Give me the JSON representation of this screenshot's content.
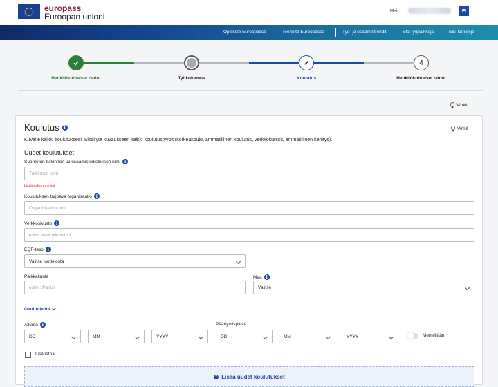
{
  "header": {
    "brand_top": "europass",
    "brand_bottom": "Euroopan unioni",
    "greeting": "Hei",
    "language": "FI",
    "colors": {
      "brand": "#8c1d4e",
      "accent": "#1e48a6"
    }
  },
  "nav": {
    "items": [
      "Opiskele Euroopassa",
      "Tee töitä Euroopassa",
      "Työ- ja osaamistrendit",
      "Etsi työpaikkoja",
      "Etsi kursseja"
    ]
  },
  "stepper": {
    "steps": [
      {
        "label": "Henkilökohtaiset tiedot",
        "state": "completed"
      },
      {
        "label": "Työkokemus",
        "state": "skipped"
      },
      {
        "label": "Koulutus",
        "state": "current"
      },
      {
        "label": "Henkilökohtaiset taidot",
        "state": "upcoming",
        "number": "4"
      }
    ],
    "current_marker": "•"
  },
  "tips_label": "Vinkit",
  "section": {
    "title": "Koulutus",
    "tips_label": "Vinkit",
    "description": "Kuvaile kaikki koulutuksesi. Sisällytä kuvaukseen kaikki koulutustyypit (korkeakoulu, ammatillinen koulutus, verkkokurssit, ammatillinen kehitys).",
    "subtitle": "Uudet koulutukset",
    "fields": {
      "degree_label": "Suoritetun tutkinnon tai osaamistodistuksen nimi",
      "degree_placeholder": "Tutkinnon nimi",
      "degree_error": "Lisää tutkinnon nimi.",
      "org_label": "Koulutuksen tarjoava organisaatio",
      "org_placeholder": "Organisaation nimi",
      "website_label": "Verkkosivusto",
      "website_placeholder": "esim. www.yliopisto.fi",
      "eqf_label": "EQF-taso",
      "eqf_value": "Valitse luettelosta",
      "city_label": "Paikkakunta",
      "city_placeholder": "esim.: Pariisi",
      "country_label": "Maa",
      "country_value": "Valitse",
      "address_toggle": "Osoitetiedot",
      "start_label": "Alkaen",
      "end_label": "Päättymispäivä",
      "day": "DD",
      "month": "MM",
      "year": "YYYY",
      "ongoing_label": "Meneillään",
      "extra_info_label": "Lisätietoa"
    },
    "add_button": "Lisää uudet koulutukset"
  }
}
